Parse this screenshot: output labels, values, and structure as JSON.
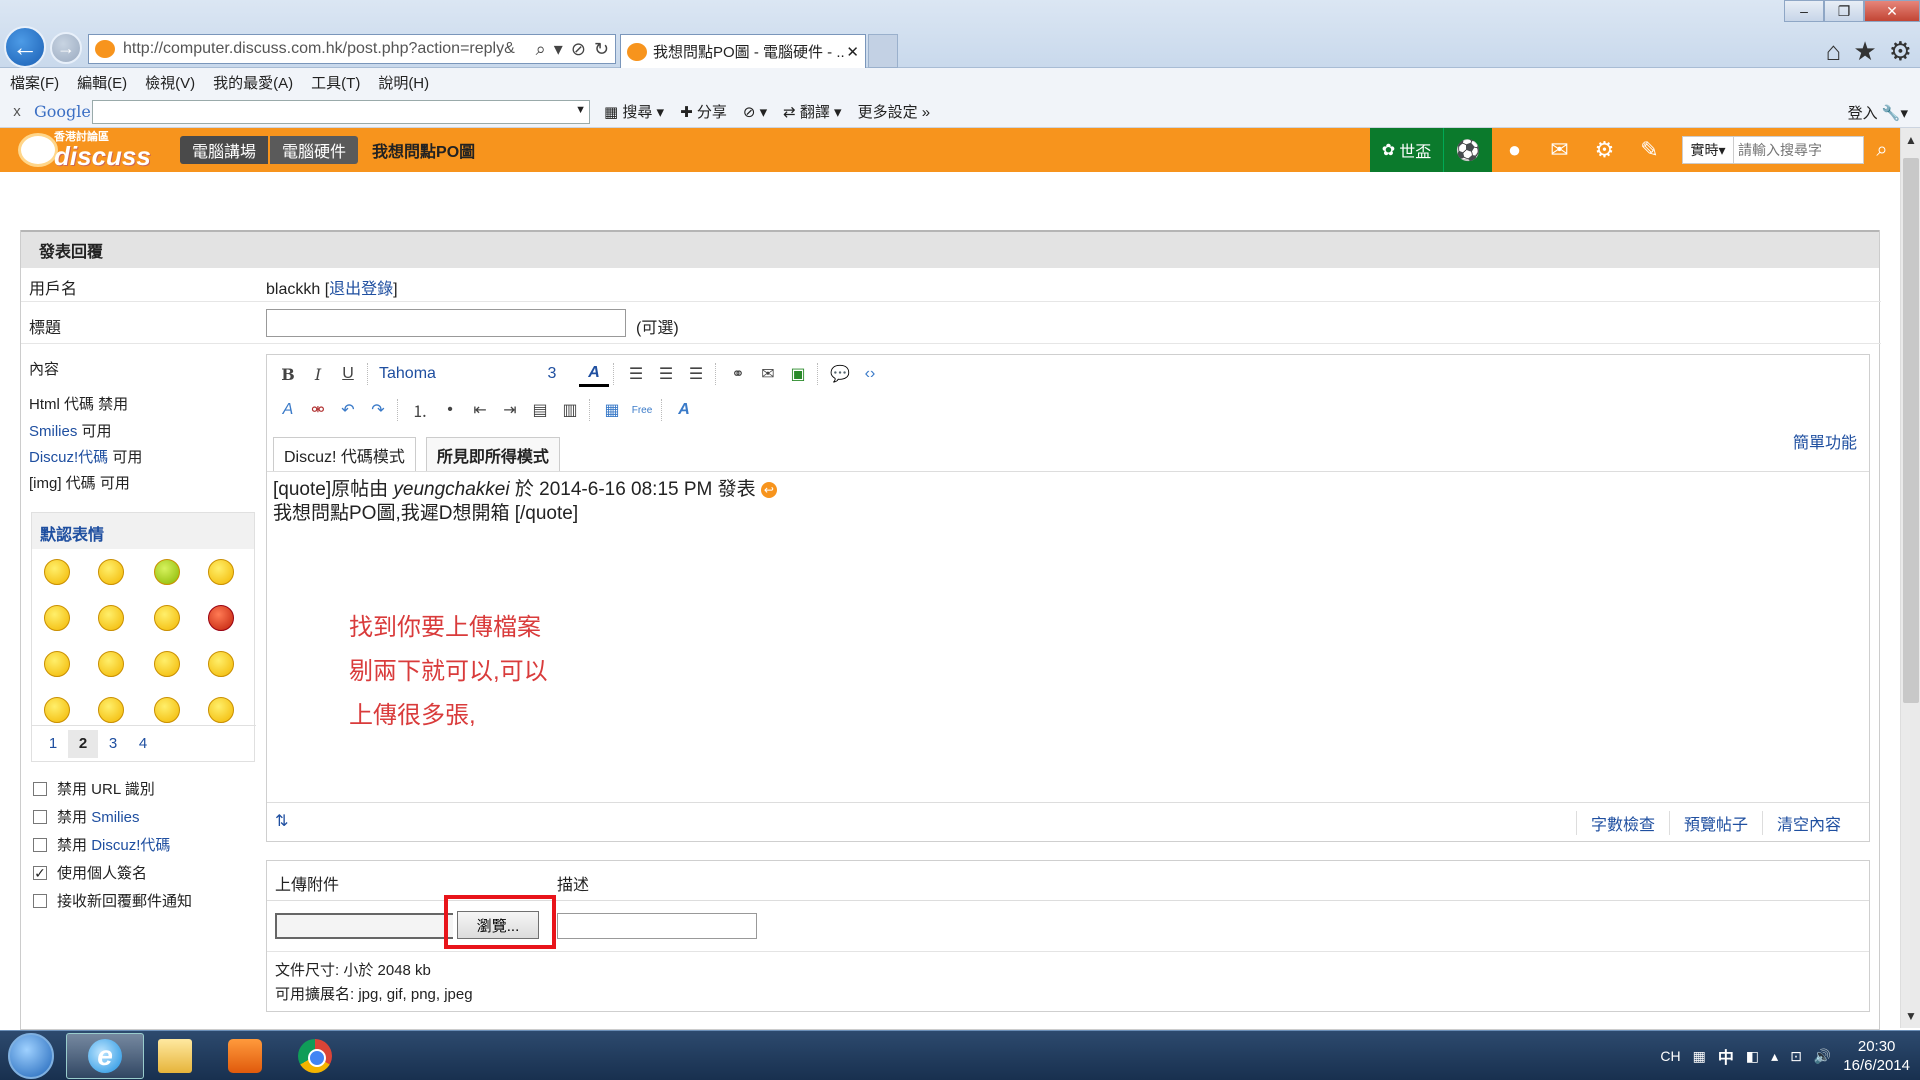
{
  "browser": {
    "url": "http://computer.discuss.com.hk/post.php?action=reply&",
    "url_domain": "discuss",
    "tab_title": "我想問點PO圖 - 電腦硬件 - ..."
  },
  "menu": [
    "檔案(F)",
    "編輯(E)",
    "檢視(V)",
    "我的最愛(A)",
    "工具(T)",
    "說明(H)"
  ],
  "google_toolbar": {
    "close": "x",
    "logo": "Google",
    "search_label": "搜尋",
    "share_label": "分享",
    "translate_label": "翻譯",
    "more_settings": "更多設定",
    "signin": "登入"
  },
  "site": {
    "logo_small": "香港討論區",
    "logo_big": "discuss",
    "crumb_forum": "電腦講場",
    "crumb_board": "電腦硬件",
    "page_title": "我想問點PO圖",
    "worldcup": "世盃",
    "search_type": "實時",
    "search_placeholder": "請輸入搜尋字"
  },
  "form": {
    "heading": "發表回覆",
    "username_label": "用戶名",
    "username": "blackkh",
    "logout": "退出登錄",
    "title_label": "標題",
    "title_optional": "(可選)",
    "content_label": "內容",
    "html_line": "Html 代碼 禁用",
    "smilies_line_link": "Smilies",
    "smilies_line_state": "可用",
    "discuz_line_link": "Discuz!代碼",
    "discuz_line_state": "可用",
    "img_line": "[img] 代碼 可用",
    "smilies_title": "默認表情",
    "smiley_pages": [
      "1",
      "2",
      "3",
      "4"
    ],
    "smiley_current_page": "2",
    "options": [
      {
        "label": "禁用 URL 識別",
        "checked": false
      },
      {
        "label_prefix": "禁用",
        "label_link": "Smilies",
        "checked": false
      },
      {
        "label_prefix": "禁用",
        "label_link": "Discuz!代碼",
        "checked": false
      },
      {
        "label": "使用個人簽名",
        "checked": true
      },
      {
        "label": "接收新回覆郵件通知",
        "checked": false
      }
    ]
  },
  "editor": {
    "font": "Tahoma",
    "size": "3",
    "mode_tab_code": "Discuz! 代碼模式",
    "mode_tab_wysiwyg": "所見即所得模式",
    "simple_link": "簡單功能",
    "quote_line1_a": "[quote]原帖由 ",
    "quote_author": "yeungchakkei",
    "quote_line1_b": " 於 2014-6-16 08:15 PM 發表 ",
    "quote_line2": "我想問點PO圖,我遲D想開箱 [/quote]",
    "annotation": "找到你要上傳檔案\n剔兩下就可以,可以\n上傳很多張,",
    "footer_links": [
      "字數檢查",
      "預覽帖子",
      "清空內容"
    ]
  },
  "attachment": {
    "upload_label": "上傳附件",
    "desc_label": "描述",
    "browse": "瀏覽...",
    "size_line": "文件尺寸: 小於 2048 kb",
    "ext_line": "可用擴展名: jpg, gif, png, jpeg"
  },
  "taskbar": {
    "lang": "CH",
    "ime": "中",
    "time": "20:30",
    "date": "16/6/2014"
  },
  "colors": {
    "site_orange": "#f7941d",
    "highlight_red": "#e8141a",
    "annotation_red": "#d93b3b",
    "link_blue": "#1f4fa0"
  }
}
